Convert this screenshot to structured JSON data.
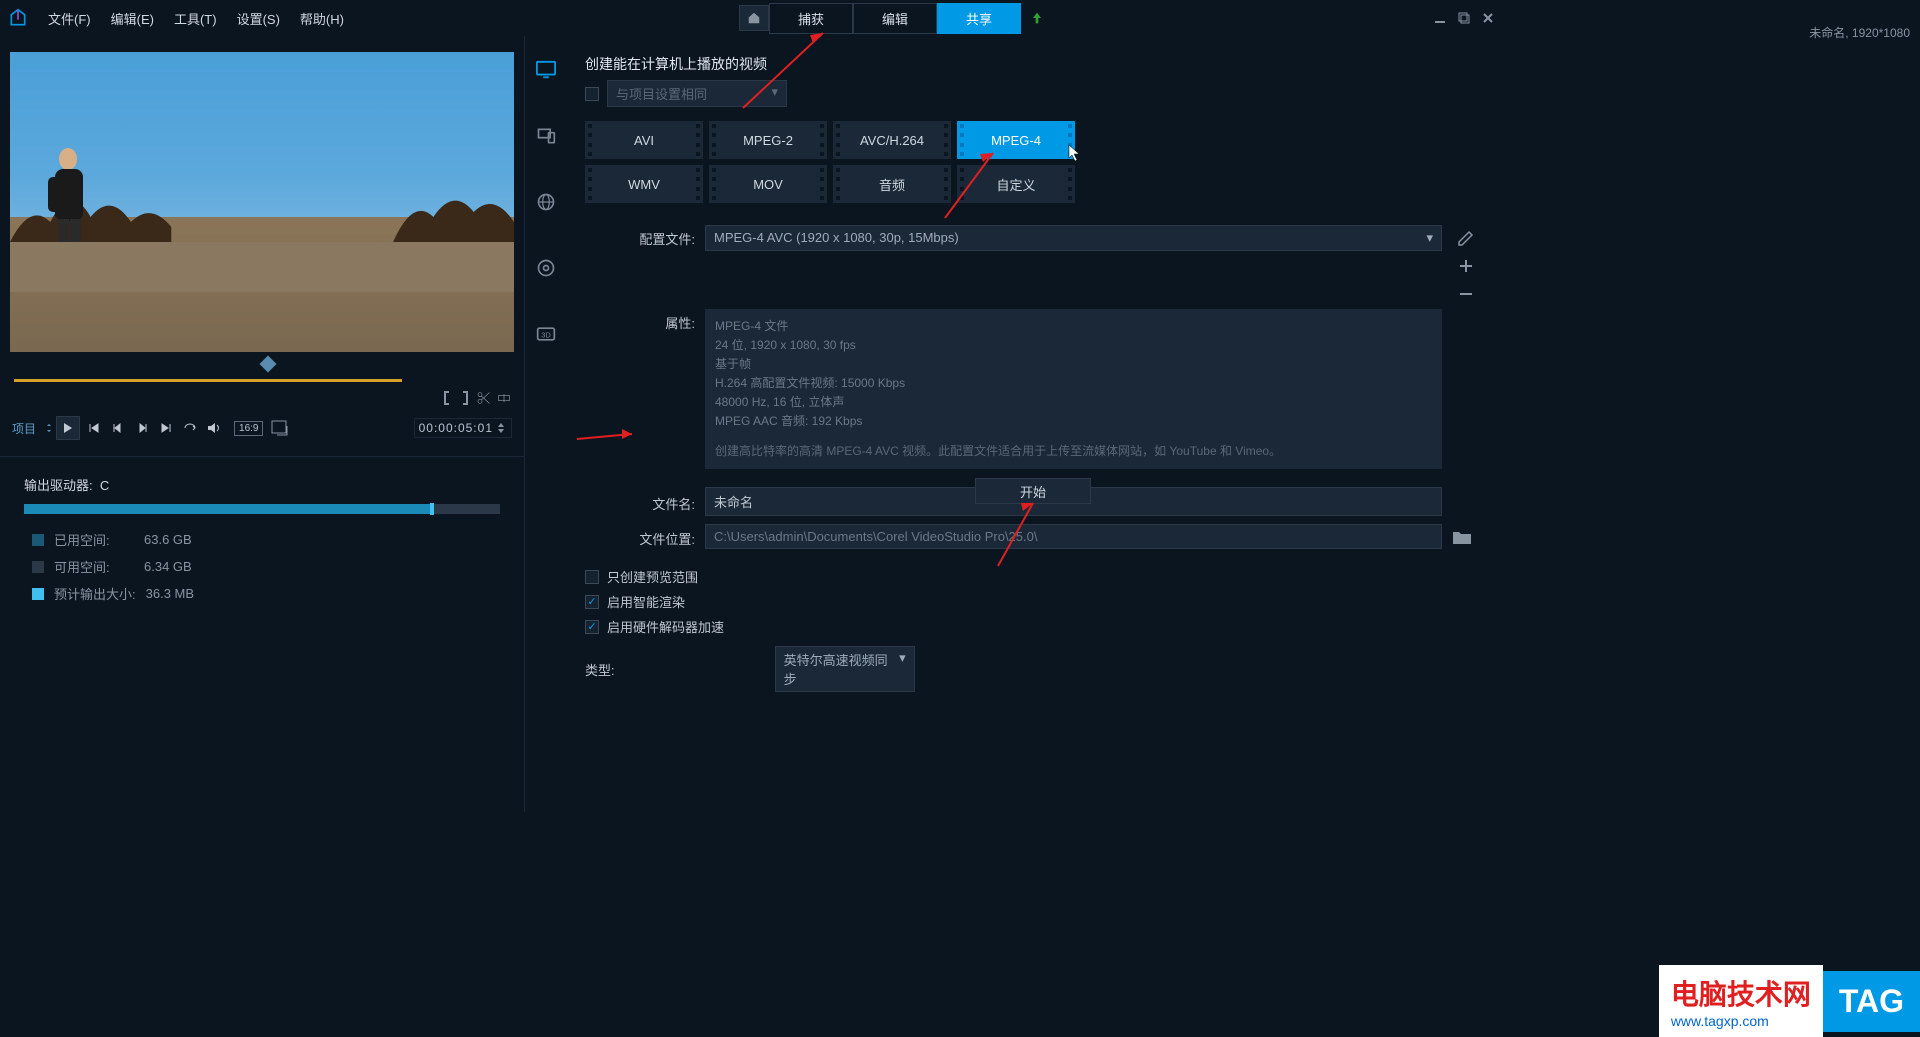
{
  "menu": {
    "file": "文件(F)",
    "edit": "编辑(E)",
    "tools": "工具(T)",
    "settings": "设置(S)",
    "help": "帮助(H)"
  },
  "tabs": {
    "capture": "捕获",
    "edit": "编辑",
    "share": "共享"
  },
  "project_status": "未命名, 1920*1080",
  "preview": {
    "project_label": "项目",
    "aspect": "16:9",
    "timecode": "00:00:05:01"
  },
  "storage": {
    "title_label": "输出驱动器:",
    "drive": "C",
    "used_label": "已用空间:",
    "used_value": "63.6 GB",
    "avail_label": "可用空间:",
    "avail_value": "6.34 GB",
    "est_label": "预计输出大小:",
    "est_value": "36.3 MB"
  },
  "share": {
    "section_title": "创建能在计算机上播放的视频",
    "same_as_project": "与项目设置相同",
    "formats": {
      "avi": "AVI",
      "mpeg2": "MPEG-2",
      "avc": "AVC/H.264",
      "mpeg4": "MPEG-4",
      "wmv": "WMV",
      "mov": "MOV",
      "audio": "音频",
      "custom": "自定义"
    },
    "config_label": "配置文件:",
    "config_value": "MPEG-4 AVC (1920 x 1080, 30p, 15Mbps)",
    "props_label": "属性:",
    "props": {
      "l1": "MPEG-4 文件",
      "l2": "24 位, 1920 x 1080, 30 fps",
      "l3": "基于帧",
      "l4": "H.264 高配置文件视频: 15000 Kbps",
      "l5": "48000 Hz, 16 位, 立体声",
      "l6": "MPEG AAC 音频: 192 Kbps",
      "desc": "创建高比特率的高清 MPEG-4 AVC 视频。此配置文件适合用于上传至流媒体网站，如 YouTube 和 Vimeo。"
    },
    "filename_label": "文件名:",
    "filename_value": "未命名",
    "location_label": "文件位置:",
    "location_value": "C:\\Users\\admin\\Documents\\Corel VideoStudio Pro\\25.0\\",
    "opt_preview": "只创建预览范围",
    "opt_smart": "启用智能渲染",
    "opt_hw": "启用硬件解码器加速",
    "type_label": "类型:",
    "type_value": "英特尔高速视频同步",
    "start_btn": "开始"
  },
  "watermark": {
    "title": "电脑技术网",
    "url": "www.tagxp.com",
    "tag": "TAG"
  }
}
